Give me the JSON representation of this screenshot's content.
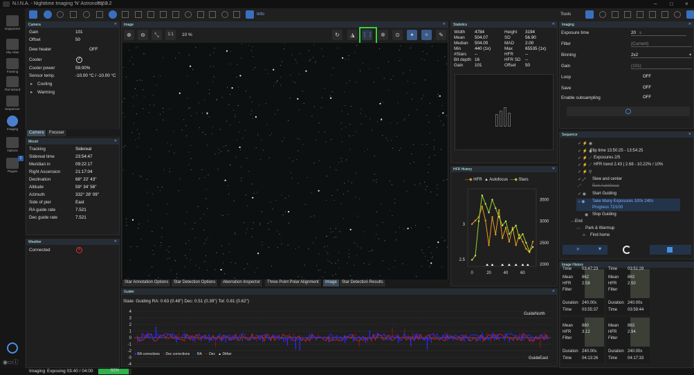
{
  "app": {
    "title": "N.I.N.A. - Nighttime Imaging 'N' Astronomy 3.2",
    "profile": "T350"
  },
  "topbar": {
    "info_label": "Info"
  },
  "sidebar": {
    "items": [
      {
        "label": "Equipment"
      },
      {
        "label": "Sky Atlas"
      },
      {
        "label": "Framing"
      },
      {
        "label": "Flat Wizard"
      },
      {
        "label": "Sequencer"
      },
      {
        "label": "Imaging"
      },
      {
        "label": "Options"
      },
      {
        "label": "Plugins"
      }
    ],
    "plugins_badge": "2"
  },
  "camera": {
    "title": "Camera",
    "rows": [
      {
        "label": "Gain",
        "value": "101"
      },
      {
        "label": "Offset",
        "value": "50"
      },
      {
        "label": "Dew heater",
        "value": "OFF"
      },
      {
        "label": "Cooler",
        "value": "✓"
      },
      {
        "label": "Cooler power",
        "value": "59.00%"
      },
      {
        "label": "Sensor temp.",
        "value": "-10.00 °C / -10.00 °C"
      }
    ],
    "expanders": [
      "Cooling",
      "Warming"
    ],
    "tabs": [
      "Camera",
      "Focuser"
    ]
  },
  "mount": {
    "title": "Mount",
    "rows": [
      {
        "label": "Tracking",
        "value": "Sidereal"
      },
      {
        "label": "Sidereal time",
        "value": "23:54:47"
      },
      {
        "label": "Meridian in",
        "value": "09:22:17"
      },
      {
        "label": "Right Ascension",
        "value": "21:17:04"
      },
      {
        "label": "Declination",
        "value": "68° 22' 43\""
      },
      {
        "label": "Altitude",
        "value": "59° 34' 56\""
      },
      {
        "label": "Azimuth",
        "value": "332° 28' 09\""
      },
      {
        "label": "Side of pier",
        "value": "East"
      },
      {
        "label": "RA guide rate",
        "value": "7.521"
      },
      {
        "label": "Dec guide rate",
        "value": "7.521"
      }
    ]
  },
  "weather": {
    "title": "Weather",
    "label": "Connected"
  },
  "image": {
    "title": "Image",
    "zoom_label": "1:1",
    "zoom_value": "10 %",
    "tabs": [
      "Star Annotation Options",
      "Star Detection Options",
      "Aberration Inspector",
      "Three Point Polar Alignment",
      "Image",
      "Star Detection Results"
    ]
  },
  "statistics": {
    "title": "Statistics",
    "left": [
      {
        "label": "Width",
        "value": "4784"
      },
      {
        "label": "Mean",
        "value": "504.07"
      },
      {
        "label": "Median",
        "value": "504.00"
      },
      {
        "label": "Min",
        "value": "440 (1x)"
      },
      {
        "label": "#Stars",
        "value": "--"
      },
      {
        "label": "Bit depth",
        "value": "16"
      },
      {
        "label": "Gain",
        "value": "101"
      }
    ],
    "right": [
      {
        "label": "Height",
        "value": "3194"
      },
      {
        "label": "SD",
        "value": "56.90"
      },
      {
        "label": "MAD",
        "value": "2.00"
      },
      {
        "label": "Max",
        "value": "65535 (1x)"
      },
      {
        "label": "HFR",
        "value": "--"
      },
      {
        "label": "HFR SD",
        "value": "--"
      },
      {
        "label": "Offset",
        "value": "50"
      }
    ]
  },
  "hfr_history": {
    "title": "HFR History",
    "legend": [
      "HFR",
      "Autofocus",
      "Stars"
    ],
    "chart_data": {
      "type": "line",
      "series": [
        {
          "name": "HFR",
          "x": [
            0,
            4,
            8,
            12,
            16,
            20,
            24,
            28,
            32,
            36,
            40,
            44,
            48,
            52,
            56,
            60,
            64,
            68,
            72
          ],
          "y": [
            3.0,
            3.05,
            3.1,
            3.25,
            3.05,
            2.7,
            3.1,
            2.85,
            3.2,
            2.8,
            2.95,
            2.75,
            2.95,
            2.7,
            2.85,
            2.75,
            2.65,
            2.6,
            2.75
          ]
        },
        {
          "name": "Stars",
          "x": [
            0,
            4,
            8,
            12,
            16,
            20,
            24,
            28,
            32,
            36,
            40,
            44,
            48,
            52,
            56,
            60,
            64,
            68,
            72
          ],
          "y": [
            2100,
            2200,
            3000,
            3600,
            3400,
            3200,
            3500,
            3300,
            3100,
            2900,
            3000,
            2700,
            2800,
            2900,
            2600,
            2700,
            2500,
            2300,
            2400
          ]
        }
      ],
      "x_ticks": [
        "0",
        "20",
        "40",
        "60"
      ],
      "y_left_ticks": [
        "3",
        "2.5"
      ],
      "y_right_ticks": [
        "3500",
        "3000",
        "2500",
        "2000"
      ],
      "autofocus_x": [
        18,
        24,
        36,
        44,
        52,
        60,
        66
      ],
      "xlim": [
        -5,
        76
      ],
      "ylim_left": [
        2.4,
        3.5
      ],
      "ylim_right": [
        1950,
        3750
      ]
    }
  },
  "guider": {
    "title": "Guider",
    "state": "State: Guiding  RA: 0.63 (0.48\")  Dec: 0.51 (0.39\")  Tot: 0.81 (0.62\")",
    "north": "GuideNorth",
    "east": "GuideEast",
    "y_ticks": [
      "4",
      "3",
      "2",
      "1",
      "0",
      "-1",
      "-2",
      "-3",
      "-4"
    ],
    "legend": [
      "RA corrections",
      "Dec corrections",
      "RA",
      "Dec",
      "Dither"
    ],
    "colors": {
      "ra": "#cc2222",
      "dec": "#2a2aff",
      "ra_corr": "#2a2aff",
      "dec_corr": "#cc2222"
    }
  },
  "tools": {
    "title": "Tools"
  },
  "imaging": {
    "title": "Imaging",
    "rows": [
      {
        "label": "Exposure time",
        "value": "20",
        "unit": "s"
      },
      {
        "label": "Filter",
        "value": "(Current)"
      },
      {
        "label": "Binning",
        "value": "2x2"
      },
      {
        "label": "Gain",
        "value": "(101)"
      },
      {
        "label": "Loop",
        "value": "OFF"
      },
      {
        "label": "Save",
        "value": "OFF"
      },
      {
        "label": "Enable subsampling",
        "value": "OFF"
      }
    ]
  },
  "sequence": {
    "title": "Sequence",
    "lines": [
      "Flip time  13:50:25 - 13:54:25",
      "Exposures  2/5",
      "HFR trend  2.43 | 2.68 - 10.22% / 10%",
      "Slew and center",
      "Run Autofocus",
      "Start Guiding",
      "Take Many Exposures  100x 240s",
      "Progress  72/100",
      "Stop Guiding",
      "End",
      "Park & Warmup",
      "Find home"
    ]
  },
  "image_history": {
    "title": "Image History",
    "cards": [
      {
        "time_top": "03:47:23",
        "mean": "862",
        "hfr": "2.58",
        "filter": "",
        "duration": "240.00s",
        "time": "03:55:37"
      },
      {
        "time_top": "03:51:29",
        "mean": "863",
        "hfr": "2.50",
        "filter": "",
        "duration": "240.00s",
        "time": "03:59:44"
      },
      {
        "time_top": "",
        "mean": "880",
        "hfr": "3.12",
        "filter": "",
        "duration": "240.00s",
        "time": "04:13:26"
      },
      {
        "time_top": "",
        "mean": "863",
        "hfr": "2.94",
        "filter": "",
        "duration": "240.00s",
        "time": "04:17:33"
      }
    ],
    "labels": {
      "mean": "Mean",
      "hfr": "HFR",
      "filter": "Filter",
      "duration": "Duration",
      "time": "Time"
    }
  },
  "status": {
    "section": "Imaging",
    "text": "Exposing 03:40 / 04:00",
    "progress_label": "92%",
    "progress": 0.92
  }
}
